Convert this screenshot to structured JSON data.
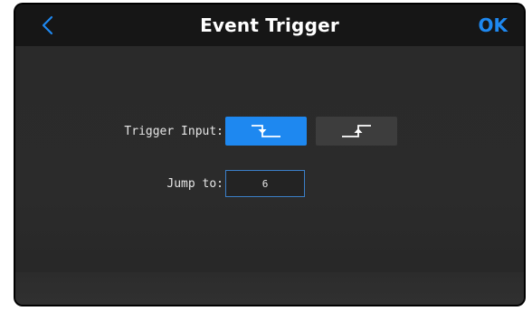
{
  "header": {
    "title": "Event Trigger",
    "ok_label": "OK",
    "back_icon": "chevron-left-icon"
  },
  "form": {
    "trigger_input_label": "Trigger Input:",
    "trigger_options": [
      {
        "name": "falling-edge",
        "icon": "falling-edge-icon",
        "selected": true
      },
      {
        "name": "rising-edge",
        "icon": "rising-edge-icon",
        "selected": false
      }
    ],
    "jump_to_label": "Jump to:",
    "jump_to_value": "6"
  },
  "colors": {
    "accent": "#1e88f0",
    "background": "#2a2a2a",
    "title_bar": "#161616",
    "unselected_button": "#3d3d3d",
    "text": "#e6e6e6"
  }
}
